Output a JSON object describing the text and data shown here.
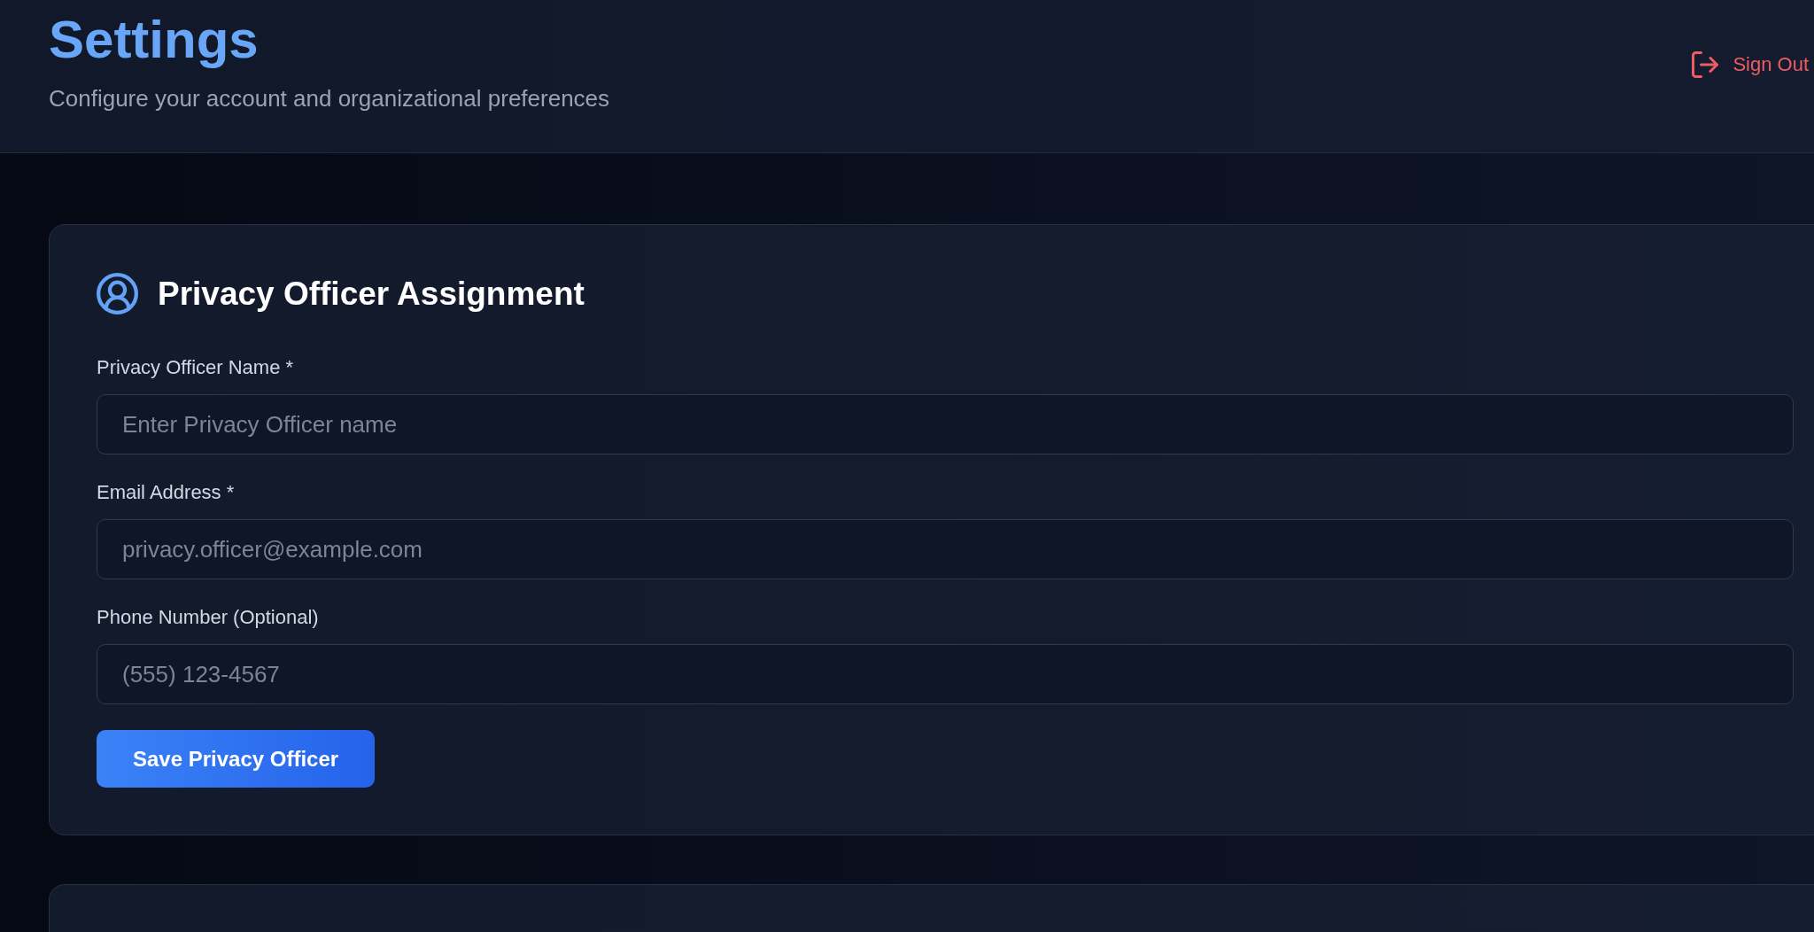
{
  "header": {
    "title": "Settings",
    "subtitle": "Configure your account and organizational preferences",
    "sign_out_button": {
      "label": "Sign Out"
    }
  },
  "privacy_officer_card": {
    "title": "Privacy Officer Assignment",
    "fields": [
      {
        "label": "Privacy Officer Name *",
        "placeholder": "Enter Privacy Officer name"
      },
      {
        "label": "Email Address *",
        "placeholder": "privacy.officer@example.com"
      },
      {
        "label": "Phone Number (Optional)",
        "placeholder": "(555) 123-4567"
      }
    ],
    "save_button": {
      "label": "Save Privacy Officer"
    }
  }
}
